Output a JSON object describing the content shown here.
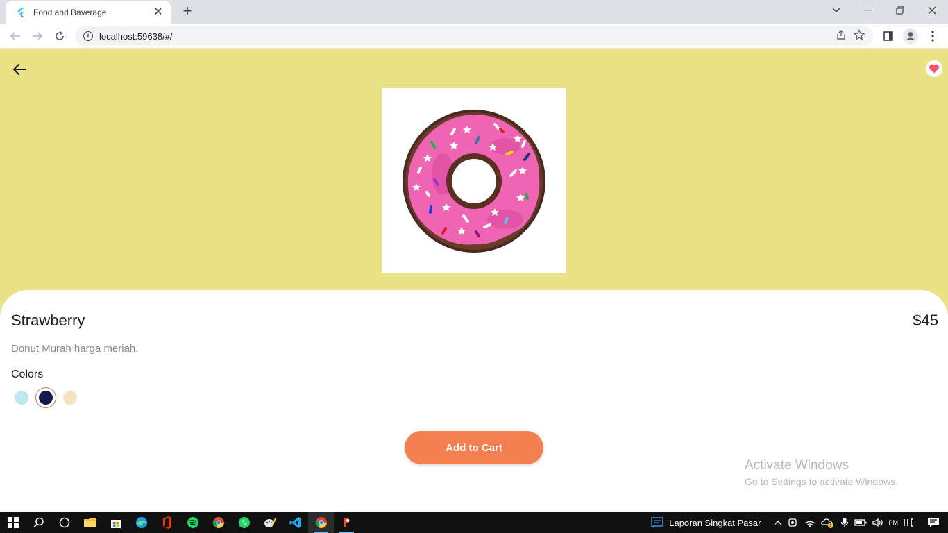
{
  "browser": {
    "tab_title": "Food and Baverage",
    "url": "localhost:59638/#/"
  },
  "app": {
    "background_color": "#ebe185",
    "product": {
      "name": "Strawberry",
      "price": "$45",
      "description": "Donut Murah harga meriah.",
      "image_icon": "donut-icon"
    },
    "colors_label": "Colors",
    "colors": [
      {
        "hex": "#bde8ef",
        "selected": false
      },
      {
        "hex": "#13194f",
        "selected": true
      },
      {
        "hex": "#f5e4c3",
        "selected": false
      }
    ],
    "add_to_cart_label": "Add to Cart",
    "accent_color": "#f47f50"
  },
  "watermark": {
    "line1": "Activate Windows",
    "line2": "Go to Settings to activate Windows."
  },
  "taskbar": {
    "active_window_title": "Laporan Singkat Pasar",
    "clock_fragment": "PM"
  }
}
